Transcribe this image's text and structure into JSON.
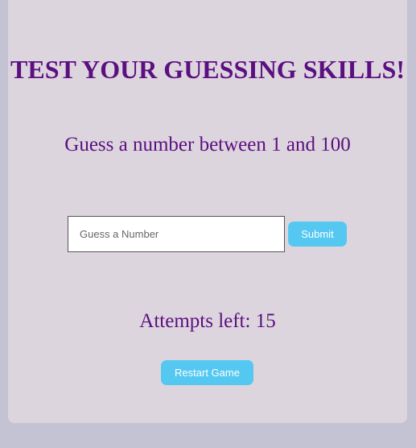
{
  "game": {
    "title": "TEST YOUR GUESSING SKILLS!",
    "subtitle": "Guess a number between 1 and 100",
    "input_placeholder": "Guess a Number",
    "input_value": "",
    "submit_label": "Submit",
    "attempts_label": "Attempts left: 15",
    "restart_label": "Restart Game"
  },
  "colors": {
    "page_background": "#c3c3d3",
    "card_background": "#ddd5de",
    "text_purple": "#5b0f80",
    "button_blue": "#54c8f0",
    "button_text": "#ffffff"
  }
}
